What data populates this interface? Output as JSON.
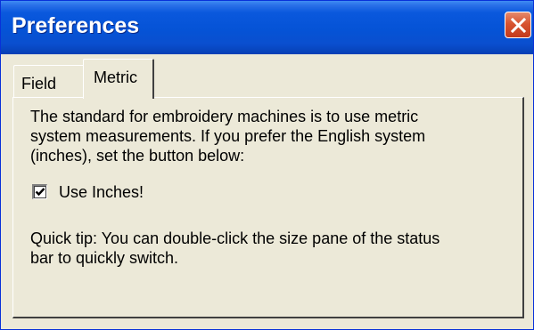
{
  "window": {
    "title": "Preferences",
    "close_icon": "close-icon"
  },
  "tabs": [
    {
      "label": "Field",
      "selected": false
    },
    {
      "label": "Metric",
      "selected": true
    }
  ],
  "metric_panel": {
    "description": "The standard for embroidery machines is to use metric\nsystem measurements. If you prefer the English system\n(inches), set the button below:",
    "checkbox": {
      "label": "Use Inches!",
      "checked": true
    },
    "tip": "Quick tip: You can double-click the size pane of the status\nbar to quickly switch."
  },
  "colors": {
    "titlebar": "#0553d6",
    "close_button": "#d85430",
    "dialog_face": "#ece9d8"
  }
}
